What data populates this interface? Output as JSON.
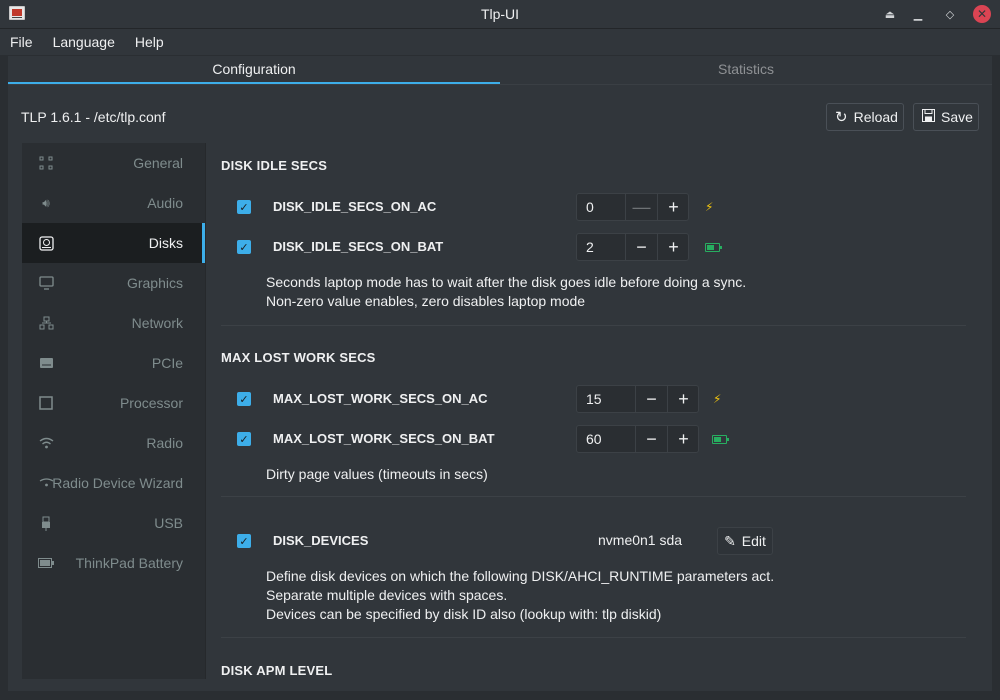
{
  "window": {
    "title": "Tlp-UI"
  },
  "menu": [
    "File",
    "Language",
    "Help"
  ],
  "tabs": [
    {
      "label": "Configuration",
      "active": true
    },
    {
      "label": "Statistics",
      "active": false
    }
  ],
  "config_path": "TLP 1.6.1 - /etc/tlp.conf",
  "toolbar": {
    "reload_label": "Reload",
    "save_label": "Save"
  },
  "sidebar": {
    "items": [
      {
        "label": "General",
        "icon": "grid-icon"
      },
      {
        "label": "Audio",
        "icon": "speaker-icon"
      },
      {
        "label": "Disks",
        "icon": "disk-icon",
        "active": true
      },
      {
        "label": "Graphics",
        "icon": "monitor-icon"
      },
      {
        "label": "Network",
        "icon": "network-icon"
      },
      {
        "label": "PCIe",
        "icon": "pcie-icon"
      },
      {
        "label": "Processor",
        "icon": "chip-icon"
      },
      {
        "label": "Radio",
        "icon": "wifi-icon"
      },
      {
        "label": "Radio Device Wizard",
        "icon": "wizard-icon"
      },
      {
        "label": "USB",
        "icon": "usb-icon"
      },
      {
        "label": "ThinkPad Battery",
        "icon": "battery-icon"
      }
    ]
  },
  "sections": {
    "disk_idle": {
      "title": "DISK IDLE SECS",
      "ac": {
        "name": "DISK_IDLE_SECS_ON_AC",
        "value": "0",
        "checked": true
      },
      "bat": {
        "name": "DISK_IDLE_SECS_ON_BAT",
        "value": "2",
        "checked": true
      },
      "desc": [
        "Seconds laptop mode has to wait after the disk goes idle before doing a sync.",
        "Non-zero value enables, zero disables laptop mode"
      ]
    },
    "max_lost": {
      "title": "MAX LOST WORK SECS",
      "ac": {
        "name": "MAX_LOST_WORK_SECS_ON_AC",
        "value": "15",
        "checked": true
      },
      "bat": {
        "name": "MAX_LOST_WORK_SECS_ON_BAT",
        "value": "60",
        "checked": true
      },
      "desc": [
        "Dirty page values (timeouts in secs)"
      ]
    },
    "disk_devices": {
      "name": "DISK_DEVICES",
      "value": "nvme0n1 sda",
      "checked": true,
      "edit_label": "Edit",
      "desc": [
        "Define disk devices on which the following DISK/AHCI_RUNTIME parameters act.",
        "Separate multiple devices with spaces.",
        "Devices can be specified by disk ID also (lookup with: tlp diskid)"
      ]
    },
    "disk_apm": {
      "title": "DISK APM LEVEL"
    }
  },
  "colors": {
    "accent": "#3daee9",
    "ac_bolt": "#f1c40f",
    "battery": "#27ae60",
    "close": "#da4453"
  }
}
